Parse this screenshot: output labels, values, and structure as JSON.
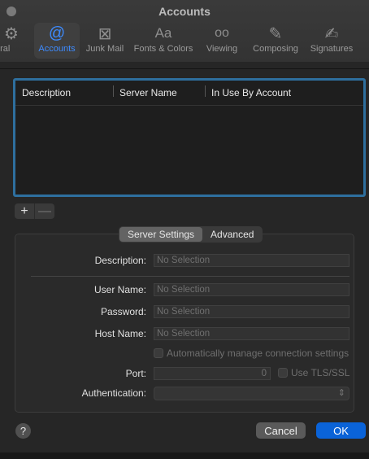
{
  "window": {
    "title": "Accounts"
  },
  "toolbar": {
    "items": [
      {
        "label": "eral",
        "icon": "gear-icon",
        "glyph": "⚙"
      },
      {
        "label": "Accounts",
        "icon": "at-icon",
        "glyph": "@"
      },
      {
        "label": "Junk Mail",
        "icon": "junk-mail-icon",
        "glyph": "⊠"
      },
      {
        "label": "Fonts & Colors",
        "icon": "fonts-icon",
        "glyph": "Aa"
      },
      {
        "label": "Viewing",
        "icon": "glasses-icon",
        "glyph": "oo"
      },
      {
        "label": "Composing",
        "icon": "compose-icon",
        "glyph": "✎"
      },
      {
        "label": "Signatures",
        "icon": "signature-icon",
        "glyph": "✍"
      }
    ],
    "active": "Accounts"
  },
  "accounts_table": {
    "columns": [
      "Description",
      "Server Name",
      "In Use By Account"
    ],
    "rows": []
  },
  "list_controls": {
    "add": "+",
    "remove": "—"
  },
  "tabs": {
    "server_settings": "Server Settings",
    "advanced": "Advanced",
    "selected": "Server Settings"
  },
  "form": {
    "description_label": "Description:",
    "description_value": "No Selection",
    "username_label": "User Name:",
    "username_value": "No Selection",
    "password_label": "Password:",
    "password_value": "No Selection",
    "hostname_label": "Host Name:",
    "hostname_value": "No Selection",
    "auto_manage_label": "Automatically manage connection settings",
    "port_label": "Port:",
    "port_value": "0",
    "tls_label": "Use TLS/SSL",
    "auth_label": "Authentication:",
    "auth_value": ""
  },
  "buttons": {
    "help": "?",
    "cancel": "Cancel",
    "ok": "OK"
  },
  "colors": {
    "accent": "#0a63d8",
    "selection_border": "#2e6f9e",
    "active_tab_text": "#3d8bff"
  }
}
